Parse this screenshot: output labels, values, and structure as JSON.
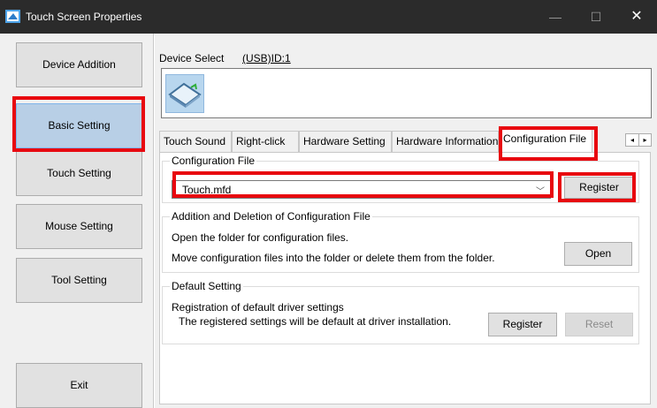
{
  "window": {
    "title": "Touch Screen Properties",
    "minimize_glyph": "—",
    "maximize_glyph": "☐",
    "close_glyph": "✕"
  },
  "sidebar": {
    "items": [
      {
        "label": "Device Addition",
        "active": false
      },
      {
        "label": "Basic Setting",
        "active": true
      },
      {
        "label": "Touch Setting",
        "active": false
      },
      {
        "label": "Mouse Setting",
        "active": false
      },
      {
        "label": "Tool Setting",
        "active": false
      }
    ],
    "exit_label": "Exit"
  },
  "device": {
    "select_label": "Device Select",
    "id": "(USB)ID:1",
    "icon": "touch-panel-icon"
  },
  "tabs": [
    {
      "label": "Touch Sound",
      "active": false
    },
    {
      "label": "Right-click",
      "active": false
    },
    {
      "label": "Hardware Setting",
      "active": false
    },
    {
      "label": "Hardware Information",
      "active": false
    },
    {
      "label": "Configuration File",
      "active": true
    }
  ],
  "tab_scroll": {
    "left": "◂",
    "right": "▸"
  },
  "config_file": {
    "group_title": "Configuration File",
    "selected": "Touch.mfd",
    "dropdown_glyph": "﹀",
    "register_label": "Register"
  },
  "add_delete": {
    "group_title": "Addition and Deletion of Configuration File",
    "line1": "Open the folder for configuration files.",
    "line2": "Move configuration files into the folder or delete them from the folder.",
    "open_label": "Open"
  },
  "default_setting": {
    "group_title": "Default Setting",
    "line1": "Registration of default driver settings",
    "line2": "The registered settings will be default at driver installation.",
    "register_label": "Register",
    "reset_label": "Reset"
  },
  "colors": {
    "highlight": "#e8080f",
    "titlebar": "#2b2b2b",
    "active_nav": "#b8cfe6"
  }
}
